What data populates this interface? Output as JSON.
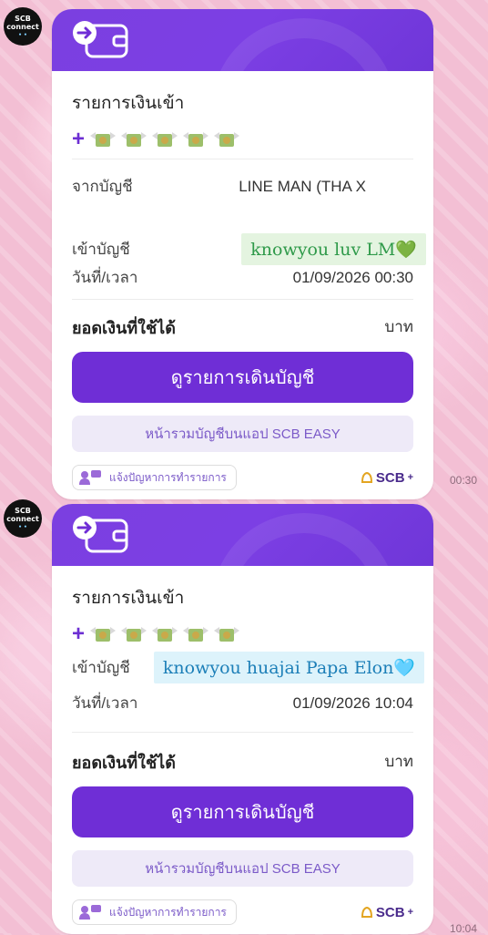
{
  "avatar": {
    "line1": "SCB",
    "line2": "connect",
    "dots": "• •"
  },
  "messages": [
    {
      "title": "รายการเงินเข้า",
      "plus": "+",
      "from_label": "จากบัญชี",
      "from_value": "LINE MAN (THA X",
      "to_label": "เข้าบัญชี",
      "to_value": "knowyou luv LM💚",
      "datetime_label": "วันที่/เวลา",
      "datetime_value": "01/09/2026 00:30",
      "balance_label": "ยอดเงินที่ใช้ได้",
      "balance_unit": "บาท",
      "primary_button": "ดูรายการเดินบัญชี",
      "secondary_button": "หน้ารวมบัญชีบนแอป SCB EASY",
      "report_button": "แจ้งปัญหาการทำรายการ",
      "brand": "SCB",
      "brand_plus": "+",
      "time": "00:30"
    },
    {
      "title": "รายการเงินเข้า",
      "plus": "+",
      "to_label": "เข้าบัญชี",
      "to_value": "knowyou huajai Papa Elon🩵",
      "datetime_label": "วันที่/เวลา",
      "datetime_value": "01/09/2026 10:04",
      "balance_label": "ยอดเงินที่ใช้ได้",
      "balance_unit": "บาท",
      "primary_button": "ดูรายการเดินบัญชี",
      "secondary_button": "หน้ารวมบัญชีบนแอป SCB EASY",
      "report_button": "แจ้งปัญหาการทำรายการ",
      "brand": "SCB",
      "brand_plus": "+",
      "time": "10:04"
    }
  ],
  "icons": {
    "wallet": "wallet-arrow-icon",
    "money": "flying-money-icon",
    "report": "report-problem-icon",
    "brand": "scb-bell-icon"
  },
  "colors": {
    "purple": "#6f2ed6",
    "light_purple": "#eeeaf8",
    "highlight_green": "#e4f4e0",
    "highlight_blue": "#ddf3fb"
  }
}
